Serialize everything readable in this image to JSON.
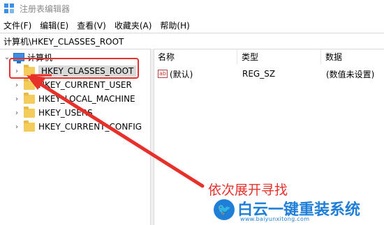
{
  "window": {
    "title": "注册表编辑器"
  },
  "menu": {
    "items": [
      "文件(F)",
      "编辑(E)",
      "查看(V)",
      "收藏夹(A)",
      "帮助(H)"
    ]
  },
  "address": {
    "path": "计算机\\HKEY_CLASSES_ROOT"
  },
  "tree": {
    "root": "计算机",
    "items": [
      "HKEY_CLASSES_ROOT",
      "HKEY_CURRENT_USER",
      "HKEY_LOCAL_MACHINE",
      "HKEY_USERS",
      "HKEY_CURRENT_CONFIG"
    ]
  },
  "list": {
    "headers": [
      "名称",
      "类型",
      "数据"
    ],
    "rows": [
      {
        "name": "(默认)",
        "type": "REG_SZ",
        "data": "(数值未设置)"
      }
    ]
  },
  "annotation": {
    "text": "依次展开寻找",
    "color": "#e8302b"
  },
  "watermark": {
    "brand": "白云一键重装系统",
    "url": "www.baiyunxitong.com",
    "color": "#1f7fd8"
  },
  "icons": {
    "ab": "ab"
  }
}
